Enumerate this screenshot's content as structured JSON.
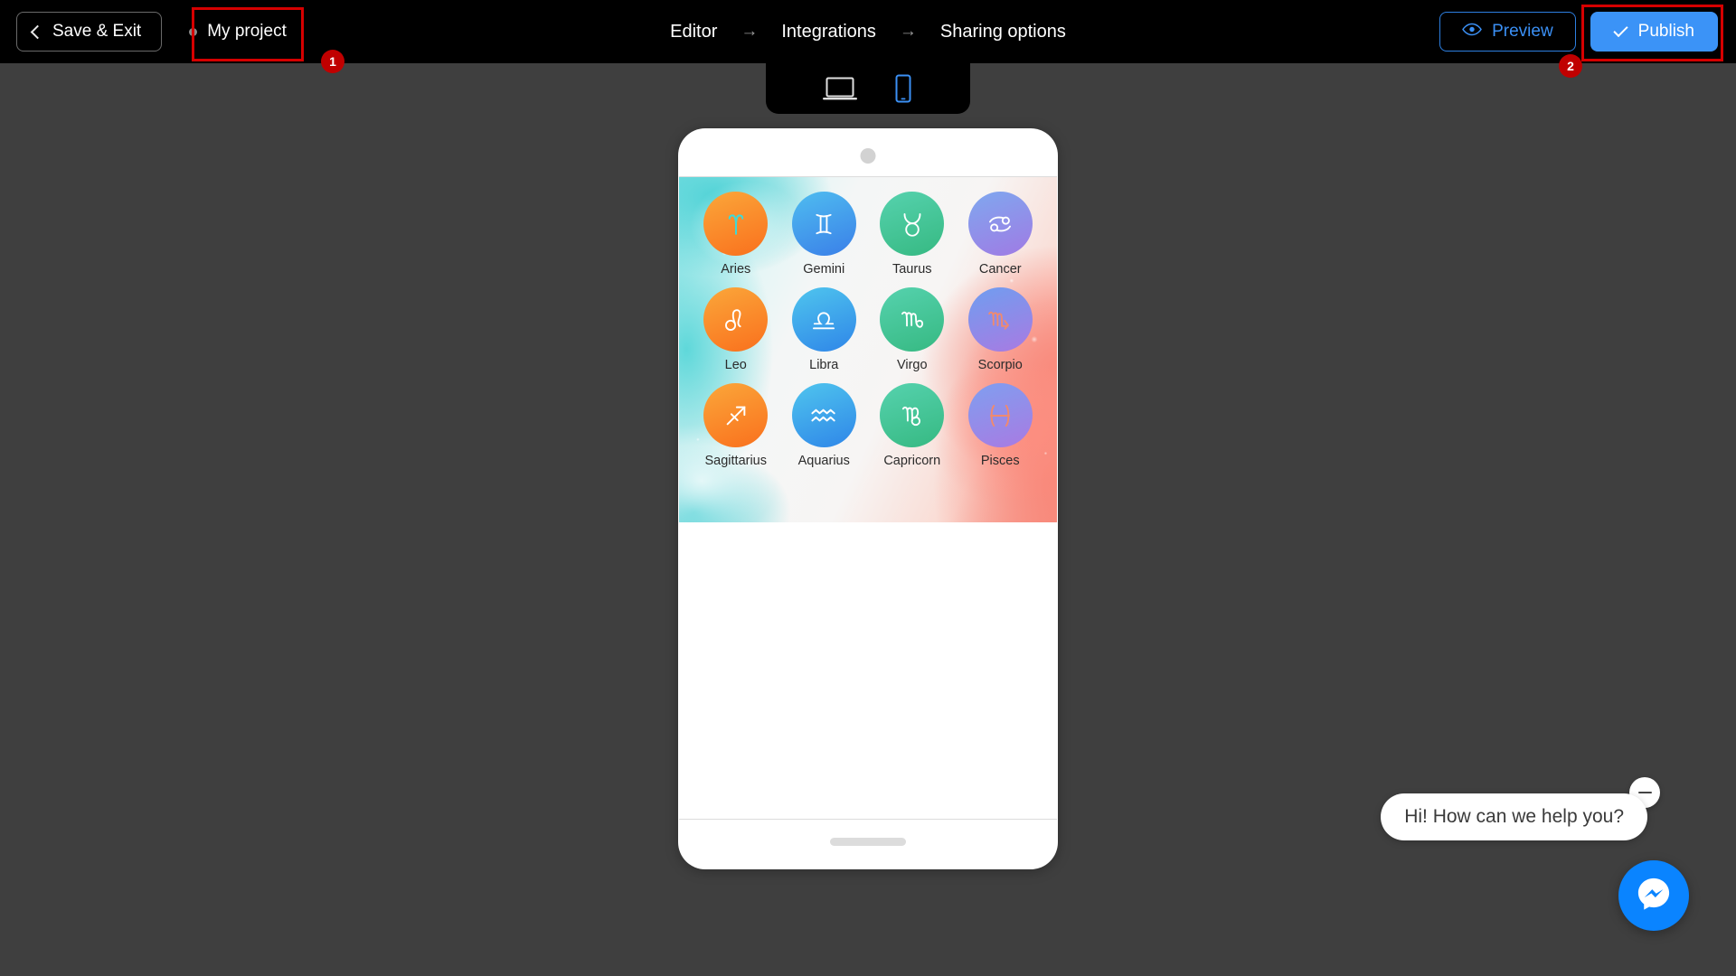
{
  "topbar": {
    "save_exit_label": "Save & Exit",
    "project_name": "My project",
    "breadcrumb": [
      {
        "label": "Editor"
      },
      {
        "label": "Integrations"
      },
      {
        "label": "Sharing options"
      }
    ],
    "breadcrumb_separator": "→",
    "preview_label": "Preview",
    "publish_label": "Publish",
    "accent_blue": "#3b93f7",
    "background": "#000000"
  },
  "annotations": [
    {
      "id": "1",
      "target": "project-button"
    },
    {
      "id": "2",
      "target": "publish-button"
    }
  ],
  "device_toggle": {
    "options": [
      {
        "name": "desktop",
        "active": false,
        "color": "#e0e0e0"
      },
      {
        "name": "mobile",
        "active": true,
        "color": "#3b90f5"
      }
    ]
  },
  "canvas": {
    "background": "#3f3f3f"
  },
  "phone_preview": {
    "device": "mobile",
    "banner": {
      "background_description": "teal-to-coral marble texture",
      "teal": "#5fd8da",
      "coral": "#f78f80"
    },
    "zodiac_signs": [
      {
        "label": "Aries",
        "symbol": "aries-icon",
        "circle_from": "#fba73a",
        "circle_to": "#f9701d",
        "glyph_color": "#3fd9d6"
      },
      {
        "label": "Gemini",
        "symbol": "gemini-icon",
        "circle_from": "#4fbdf0",
        "circle_to": "#3a7fe8",
        "glyph_color": "#ffffff"
      },
      {
        "label": "Taurus",
        "symbol": "taurus-icon",
        "circle_from": "#56d2ae",
        "circle_to": "#36b982",
        "glyph_color": "#ffffff"
      },
      {
        "label": "Cancer",
        "symbol": "cancer-icon",
        "circle_from": "#7fa8ef",
        "circle_to": "#a07ae4",
        "glyph_color": "#ffffff"
      },
      {
        "label": "Leo",
        "symbol": "leo-icon",
        "circle_from": "#fba73a",
        "circle_to": "#f9701d",
        "glyph_color": "#ffffff"
      },
      {
        "label": "Libra",
        "symbol": "libra-icon",
        "circle_from": "#4fc5ee",
        "circle_to": "#2f86e8",
        "glyph_color": "#ffffff"
      },
      {
        "label": "Virgo",
        "symbol": "virgo-icon",
        "circle_from": "#56d2ae",
        "circle_to": "#36b982",
        "glyph_color": "#ffffff"
      },
      {
        "label": "Scorpio",
        "symbol": "scorpio-icon",
        "circle_from": "#6f9ef0",
        "circle_to": "#a97ae2",
        "glyph_color": "#f08a6e"
      },
      {
        "label": "Sagittarius",
        "symbol": "sagittarius-icon",
        "circle_from": "#fba73a",
        "circle_to": "#f9701d",
        "glyph_color": "#ffffff"
      },
      {
        "label": "Aquarius",
        "symbol": "aquarius-icon",
        "circle_from": "#4fc5ee",
        "circle_to": "#2f86e8",
        "glyph_color": "#ffffff"
      },
      {
        "label": "Capricorn",
        "symbol": "capricorn-icon",
        "circle_from": "#56d2ae",
        "circle_to": "#36b982",
        "glyph_color": "#ffffff"
      },
      {
        "label": "Pisces",
        "symbol": "pisces-icon",
        "circle_from": "#7f9ff0",
        "circle_to": "#a97ae2",
        "glyph_color": "#f08a6e"
      }
    ]
  },
  "chat_widget": {
    "greeting": "Hi! How can we help you?",
    "provider": "messenger",
    "fab_color": "#0a84ff"
  }
}
